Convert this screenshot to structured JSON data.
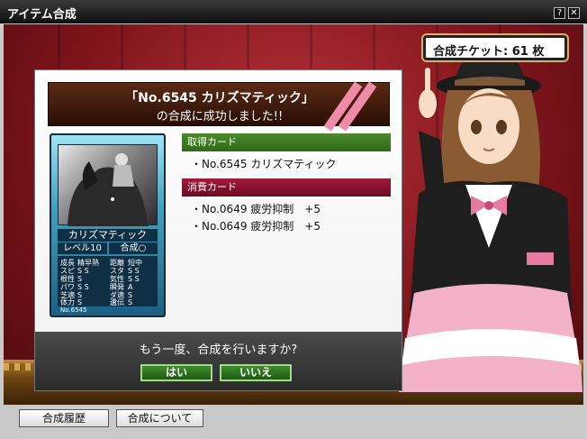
{
  "window": {
    "title": "アイテム合成",
    "help_label": "?",
    "close_label": "✕"
  },
  "ticket": {
    "text": "合成チケット: 61 枚"
  },
  "banner": {
    "line1": "「No.6545 カリズマティック」",
    "line2": "の合成に成功しました!!"
  },
  "card": {
    "name": "カリズマティック",
    "level": "レベル10",
    "synth": "合成○",
    "stats": [
      {
        "label": "成長",
        "value": "精早熟"
      },
      {
        "label": "距離",
        "value": "短中"
      },
      {
        "label": "スピ",
        "value": "S S"
      },
      {
        "label": "スタ",
        "value": "S S"
      },
      {
        "label": "根性",
        "value": "S"
      },
      {
        "label": "気性",
        "value": "S S"
      },
      {
        "label": "パワ",
        "value": "S S"
      },
      {
        "label": "瞬発",
        "value": "A"
      },
      {
        "label": "芝適",
        "value": "S"
      },
      {
        "label": "ダ適",
        "value": "S"
      },
      {
        "label": "体力",
        "value": "S"
      },
      {
        "label": "遺伝",
        "value": "S"
      }
    ],
    "number": "No.6545"
  },
  "acquired": {
    "header": "取得カード",
    "items": [
      "・No.6545 カリズマティック"
    ]
  },
  "consumed": {
    "header": "消費カード",
    "items": [
      "・No.0649 疲労抑制　+5",
      "・No.0649 疲労抑制　+5"
    ]
  },
  "prompt": {
    "question": "もう一度、合成を行いますか?",
    "yes_label": "はい",
    "no_label": "いいえ"
  },
  "footer": {
    "history_label": "合成履歴",
    "about_label": "合成について"
  },
  "colors": {
    "accent_green": "#2f6a16",
    "accent_red": "#6b0b22",
    "stage_red": "#8a1a20"
  }
}
